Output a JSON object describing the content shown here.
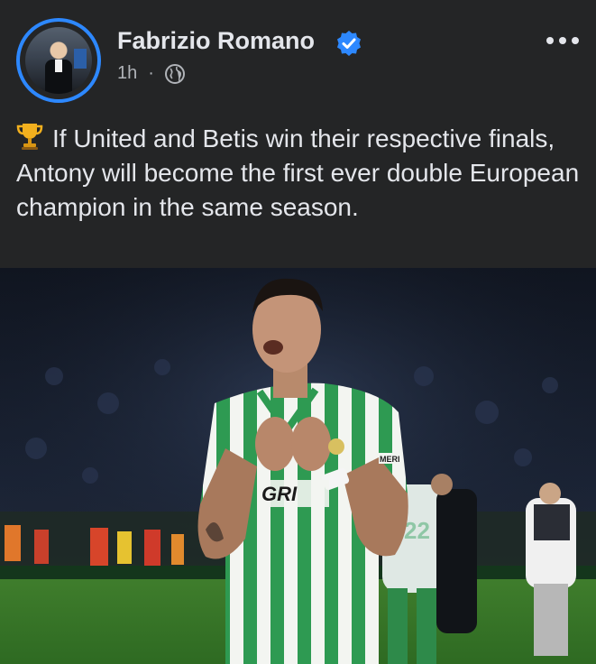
{
  "post": {
    "author": "Fabrizio Romano",
    "verified_icon": "verified-badge-icon",
    "time": "1h",
    "separator": "·",
    "audience_icon": "globe-icon",
    "more_icon": "more-options-icon",
    "caption_icon": "trophy-icon",
    "caption": "If United and Betis win their respective finals, Antony will become the first ever double European champion in the same season."
  },
  "photo": {
    "subject": "football player in green and white striped kit",
    "shirt_text_sponsor": "GRI",
    "shirt_text_patch": "MERI",
    "background_player_number": "22"
  },
  "colors": {
    "background": "#242526",
    "accent": "#2d88ff",
    "text_primary": "#e4e6eb",
    "text_secondary": "#b0b3b8",
    "kit_green": "#2e9a52"
  }
}
